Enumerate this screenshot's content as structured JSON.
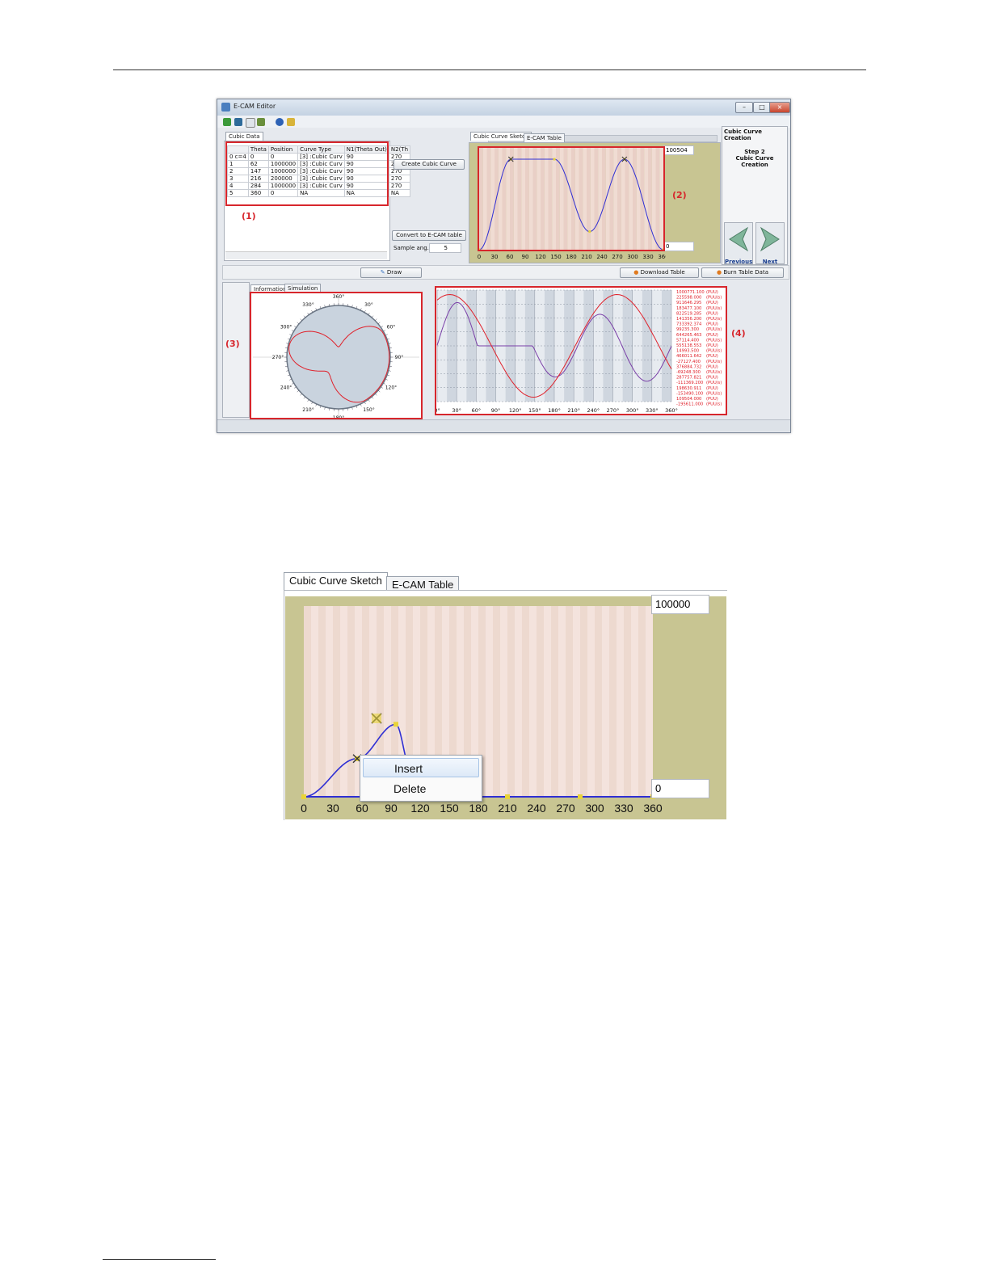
{
  "window": {
    "title": "E-CAM Editor",
    "controls": [
      "–",
      "□",
      "×"
    ]
  },
  "cubic_data": {
    "tab_label": "Cubic Data",
    "columns": [
      "",
      "Theta",
      "Position",
      "Curve Type",
      "N1(Theta Out)",
      "N2(Th"
    ],
    "rows": [
      [
        "0 c=4",
        "0",
        "0",
        "[3] :Cubic Curv",
        "90",
        "270"
      ],
      [
        "1",
        "62",
        "1000000",
        "[3] :Cubic Curv",
        "90",
        "270"
      ],
      [
        "2",
        "147",
        "1000000",
        "[3] :Cubic Curv",
        "90",
        "270"
      ],
      [
        "3",
        "216",
        "200000",
        "[3] :Cubic Curv",
        "90",
        "270"
      ],
      [
        "4",
        "284",
        "1000000",
        "[3] :Cubic Curv",
        "90",
        "270"
      ],
      [
        "5",
        "360",
        "0",
        "NA",
        "NA",
        "NA"
      ]
    ]
  },
  "buttons": {
    "create": "Create Cubic Curve",
    "convert": "Convert to E-CAM table",
    "draw": "Draw",
    "download": "Download Table",
    "burn": "Burn Table Data",
    "previous": "Previous",
    "next": "Next"
  },
  "sample_ang": {
    "label": "Sample ang.:",
    "value": "5"
  },
  "sketch_tabs": [
    "Cubic Curve Sketch",
    "E-CAM Table"
  ],
  "sketch": {
    "max_value": "100504",
    "min_value": "0",
    "x_ticks": [
      "0",
      "30",
      "60",
      "90",
      "120",
      "150",
      "180",
      "210",
      "240",
      "270",
      "300",
      "330",
      "360"
    ]
  },
  "wizard": {
    "header": "Cubic Curve Creation",
    "step": "Step 2",
    "step_name": "Cubic Curve Creation"
  },
  "bottom_tabs": [
    "Information",
    "Simulation"
  ],
  "polar_labels": [
    "360°",
    "30°",
    "60°",
    "90°",
    "120°",
    "150°",
    "180°",
    "210°",
    "240°",
    "270°",
    "300°",
    "330°"
  ],
  "sim_x_ticks": [
    "0°",
    "30°",
    "60°",
    "90°",
    "120°",
    "150°",
    "180°",
    "210°",
    "240°",
    "270°",
    "300°",
    "330°",
    "360°"
  ],
  "sim_readout": [
    [
      "1000771.100",
      "(PUU)"
    ],
    [
      "225598.000",
      "(PUU/s)"
    ],
    [
      "911646.295",
      "(PUU)"
    ],
    [
      "183477.100",
      "(PUU/s)"
    ],
    [
      "822519.285",
      "(PUU)"
    ],
    [
      "141356.200",
      "(PUU/s)"
    ],
    [
      "733392.374",
      "(PUU)"
    ],
    [
      "99235.300",
      "(PUU/s)"
    ],
    [
      "644265.463",
      "(PUU)"
    ],
    [
      "57114.400",
      "(PUU/s)"
    ],
    [
      "555138.553",
      "(PUU)"
    ],
    [
      "14993.500",
      "(PUU/s)"
    ],
    [
      "466011.642",
      "(PUU)"
    ],
    [
      "-27127.400",
      "(PUU/s)"
    ],
    [
      "376884.732",
      "(PUU)"
    ],
    [
      "-69248.300",
      "(PUU/s)"
    ],
    [
      "287757.821",
      "(PUU)"
    ],
    [
      "-111369.200",
      "(PUU/s)"
    ],
    [
      "198630.911",
      "(PUU)"
    ],
    [
      "-153490.100",
      "(PUU/s)"
    ],
    [
      "109504.000",
      "(PUU)"
    ],
    [
      "-195611.000",
      "(PUU/s)"
    ]
  ],
  "region_labels": [
    "(1)",
    "(2)",
    "(3)",
    "(4)"
  ],
  "zoom": {
    "tabs": [
      "Cubic Curve Sketch",
      "E-CAM Table"
    ],
    "max_value": "100000",
    "min_value": "0",
    "x_ticks": [
      "0",
      "30",
      "60",
      "90",
      "120",
      "150",
      "180",
      "210",
      "240",
      "270",
      "300",
      "330",
      "360"
    ],
    "context_menu": [
      "Insert",
      "Delete"
    ]
  },
  "colors": {
    "accent_red": "#d7262c",
    "curve_blue": "#2f2fd4",
    "curve_red": "#e0202a",
    "chart_bg": "#c8c592"
  }
}
